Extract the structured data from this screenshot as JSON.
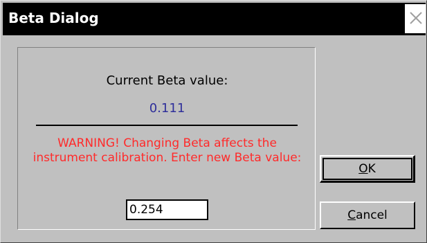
{
  "window": {
    "title": "Beta Dialog",
    "close_icon": "close-icon"
  },
  "panel": {
    "current_label": "Current Beta value:",
    "current_value": "0.111",
    "warning_line1": "WARNING! Changing Beta affects the",
    "warning_line2": "instrument calibration. Enter new Beta value:",
    "input_value": "0.254"
  },
  "buttons": {
    "ok": {
      "mnemonic": "O",
      "rest": "K"
    },
    "cancel": {
      "mnemonic": "C",
      "rest": "ancel"
    }
  },
  "colors": {
    "dialog_bg": "#c0c0c0",
    "titlebar": "#000000",
    "current_value": "#2e2e9a",
    "warning": "#ff2a2a"
  }
}
